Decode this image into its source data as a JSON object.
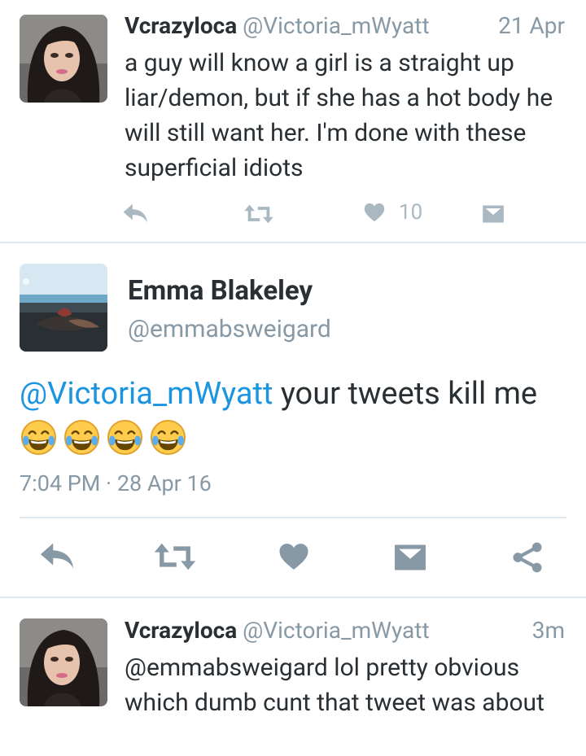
{
  "tweet1": {
    "name": "Vcrazyloca",
    "handle": "@Victoria_mWyatt",
    "time": "21 Apr",
    "text": "a guy will know a girl is a straight up liar/demon, but if she has a hot body he will still want her. I'm done with these superficial idiots",
    "like_count": "10",
    "icons": [
      "reply-icon",
      "retweet-icon",
      "heart-icon",
      "dm-icon"
    ]
  },
  "focused": {
    "name": "Emma Blakeley",
    "handle": "@emmabsweigard",
    "mention": "@Victoria_mWyatt",
    "text": " your tweets kill me",
    "emoji": [
      "😂",
      "😂",
      "😂",
      "😂"
    ],
    "meta": "7:04 PM · 28 Apr 16",
    "icons": [
      "reply-icon",
      "retweet-icon",
      "heart-icon",
      "dm-icon",
      "share-icon"
    ]
  },
  "tweet3": {
    "name": "Vcrazyloca",
    "handle": "@Victoria_mWyatt",
    "time": "3m",
    "text": "@emmabsweigard lol pretty obvious which dumb cunt that tweet was about"
  },
  "colors": {
    "text": "#292f33",
    "secondary": "#8899a6",
    "mention": "#1b95e0",
    "icon_small": "#aab8c2",
    "icon_large": "#8899a6",
    "divider": "#e1e8ed"
  }
}
